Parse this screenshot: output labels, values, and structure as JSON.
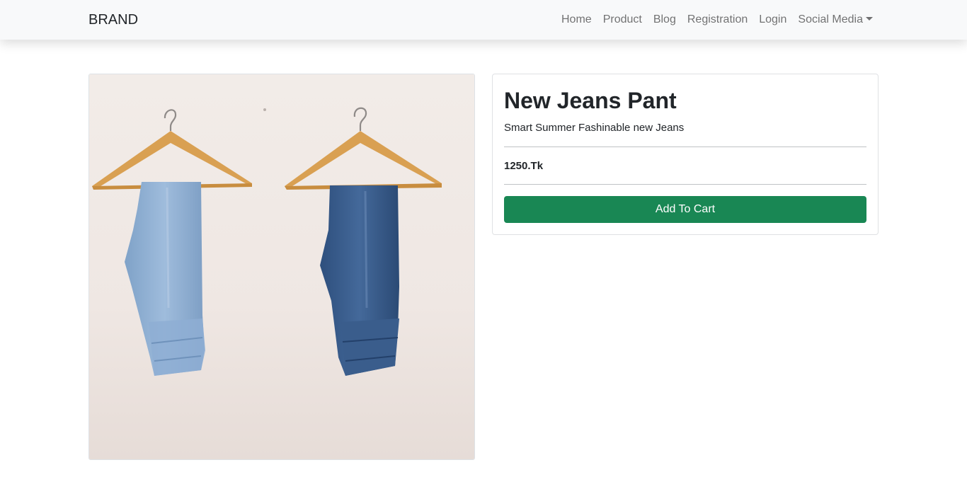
{
  "navbar": {
    "brand": "BRAND",
    "links": [
      {
        "label": "Home"
      },
      {
        "label": "Product"
      },
      {
        "label": "Blog"
      },
      {
        "label": "Registration"
      },
      {
        "label": "Login"
      },
      {
        "label": "Social Media"
      }
    ]
  },
  "product": {
    "image_icon": "jeans-on-hangers-photo",
    "title": "New Jeans Pant",
    "description": "Smart Summer Fashinable new Jeans",
    "price": "1250.Tk",
    "add_to_cart_label": "Add To Cart"
  },
  "colors": {
    "navbar_bg": "#f8f9fa",
    "button_bg": "#198754",
    "button_text": "#ffffff",
    "nav_link": "#6c757d"
  }
}
